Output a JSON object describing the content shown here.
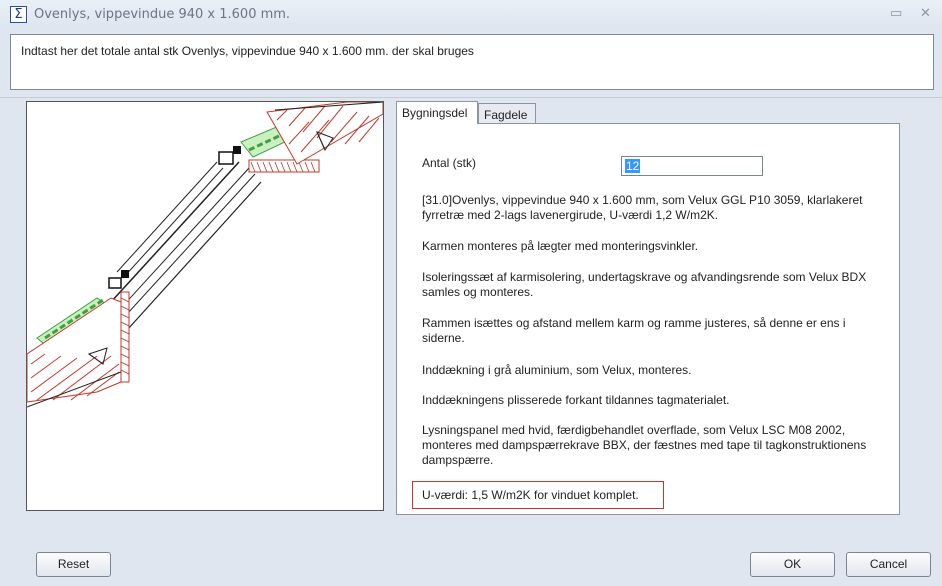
{
  "window": {
    "title": "Ovenlys, vippevindue 940 x 1.600 mm.",
    "icon": "sigma-icon",
    "min_glyph": "▭",
    "close_glyph": "✕"
  },
  "instruction": "Indtast her det totale antal stk Ovenlys, vippevindue 940 x 1.600 mm. der skal bruges",
  "tabs": [
    {
      "label": "Bygningsdel",
      "active": true
    },
    {
      "label": "Fagdele",
      "active": false
    }
  ],
  "quantity": {
    "label": "Antal (stk)",
    "value": "12"
  },
  "description": [
    "[31.0]Ovenlys, vippevindue 940 x 1.600 mm, som Velux GGL P10 3059, klarlakeret fyrretræ med 2-lags lavenergirude, U-værdi 1,2 W/m2K.",
    "Karmen monteres på lægter med monteringsvinkler.",
    "Isoleringssæt af karmisolering, undertagskrave og afvandingsrende som Velux BDX samles og monteres.",
    "Rammen isættes og afstand mellem karm og ramme justeres, så denne er ens i siderne.",
    "Inddækning i grå aluminium, som Velux, monteres.",
    "Inddækningens plisserede forkant tildannes tagmaterialet.",
    "Lysningspanel med hvid, færdigbehandlet overflade, som Velux LSC M08 2002, monteres med dampspærrekrave BBX, der fæstnes med tape til tagkonstruktionens dampspærre."
  ],
  "highlight": "U-værdi: 1,5 W/m2K for vinduet komplet.",
  "buttons": {
    "reset": "Reset",
    "ok": "OK",
    "cancel": "Cancel"
  },
  "colors": {
    "highlight_border": "#c0392b",
    "selection": "#3399ff",
    "insulation_green": "#3fa03f",
    "brick_red": "#c0392b"
  }
}
